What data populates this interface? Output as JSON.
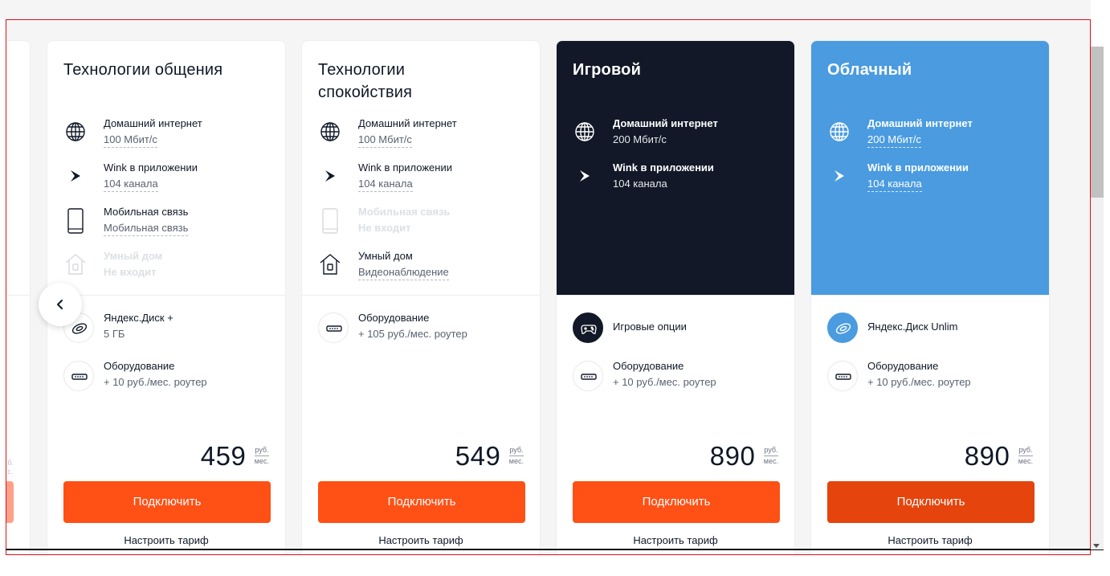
{
  "carousel": {
    "prev_label": "‹",
    "partial_card": {
      "unit_rub": "б.",
      "unit_mes": "с."
    },
    "cards": [
      {
        "title": "Технологии общения",
        "features": [
          {
            "icon": "globe-icon",
            "name": "Домашний интернет",
            "value": "100 Мбит/с",
            "dim": false
          },
          {
            "icon": "wink-icon",
            "name": "Wink в приложении",
            "value": "104 канала",
            "dim": false
          },
          {
            "icon": "phone-icon",
            "name": "Мобильная связь",
            "value": "Мобильная связь",
            "dim": false
          },
          {
            "icon": "smart-home-icon",
            "name": "Умный дом",
            "value": "Не входит",
            "dim": true
          }
        ],
        "options": [
          {
            "icon": "yandex-disk-icon",
            "name": "Яндекс.Диск +",
            "sub": "5 ГБ"
          },
          {
            "icon": "router-icon",
            "name": "Оборудование",
            "sub": "+ 10 руб./мес. роутер"
          }
        ],
        "price": "459",
        "unit_top": "руб.",
        "unit_bottom": "мес.",
        "button": "Подключить",
        "configure": "Настроить тариф"
      },
      {
        "title": "Технологии спокойствия",
        "features": [
          {
            "icon": "globe-icon",
            "name": "Домашний интернет",
            "value": "100 Мбит/с",
            "dim": false
          },
          {
            "icon": "wink-icon",
            "name": "Wink в приложении",
            "value": "104 канала",
            "dim": false
          },
          {
            "icon": "phone-icon",
            "name": "Мобильная связь",
            "value": "Не входит",
            "dim": true
          },
          {
            "icon": "smart-home-icon",
            "name": "Умный дом",
            "value": "Видеонаблюдение",
            "dim": false
          }
        ],
        "options": [
          {
            "icon": "router-icon",
            "name": "Оборудование",
            "sub": "+ 105 руб./мес. роутер"
          }
        ],
        "price": "549",
        "unit_top": "руб.",
        "unit_bottom": "мес.",
        "button": "Подключить",
        "configure": "Настроить тариф"
      },
      {
        "title": "Игровой",
        "features": [
          {
            "icon": "globe-icon",
            "name": "Домашний интернет",
            "value": "200 Мбит/с",
            "dim": false
          },
          {
            "icon": "wink-icon",
            "name": "Wink в приложении",
            "value": "104 канала",
            "dim": false
          }
        ],
        "options": [
          {
            "icon": "gamepad-icon",
            "name": "Игровые опции",
            "sub": ""
          },
          {
            "icon": "router-icon",
            "name": "Оборудование",
            "sub": "+ 10 руб./мес. роутер"
          }
        ],
        "price": "890",
        "unit_top": "руб.",
        "unit_bottom": "мес.",
        "button": "Подключить",
        "configure": "Настроить тариф"
      },
      {
        "title": "Облачный",
        "features": [
          {
            "icon": "globe-icon",
            "name": "Домашний интернет",
            "value": "200 Мбит/с",
            "dim": false
          },
          {
            "icon": "wink-icon",
            "name": "Wink в приложении",
            "value": "104 канала",
            "dim": false
          }
        ],
        "options": [
          {
            "icon": "yandex-disk-icon",
            "name": "Яндекс.Диск Unlim",
            "sub": ""
          },
          {
            "icon": "router-icon",
            "name": "Оборудование",
            "sub": "+ 10 руб./мес. роутер"
          }
        ],
        "price": "890",
        "unit_top": "руб.",
        "unit_bottom": "мес.",
        "button": "Подключить",
        "configure": "Настроить тариф"
      }
    ]
  },
  "colors": {
    "accent": "#ff5015",
    "accent_pressed": "#e5440c",
    "dark_card": "#121827",
    "blue_card": "#4a9be0",
    "frame_border": "#e0101a"
  }
}
